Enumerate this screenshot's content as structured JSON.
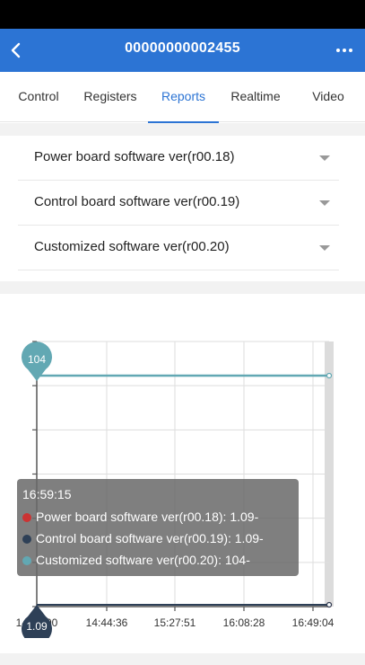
{
  "header": {
    "title": "00000000002455",
    "back_icon": "chevron-left-icon",
    "more_icon": "more-horizontal-icon",
    "background": "#2c74d4"
  },
  "tabs": [
    {
      "label": "Control",
      "active": false
    },
    {
      "label": "Registers",
      "active": false
    },
    {
      "label": "Reports",
      "active": true
    },
    {
      "label": "Realtime",
      "active": false
    },
    {
      "label": "Video",
      "active": false
    }
  ],
  "selects": [
    {
      "label": "Power board software ver(r00.18)"
    },
    {
      "label": "Control board software ver(r00.19)"
    },
    {
      "label": "Customized software ver(r00.20)"
    }
  ],
  "chart_data": {
    "type": "line",
    "x": [
      "14:04:00",
      "16:59:15"
    ],
    "xticks": [
      "14:04:00",
      "14:44:36",
      "15:27:51",
      "16:08:28",
      "16:49:04"
    ],
    "series": [
      {
        "name": "Power board software ver(r00.18)",
        "color": "#cc3333",
        "values": [
          "1.09-",
          "1.09-"
        ]
      },
      {
        "name": "Control board software ver(r00.19)",
        "color": "#2e4057",
        "values": [
          "1.09-",
          "1.09-"
        ]
      },
      {
        "name": "Customized software ver(r00.20)",
        "color": "#62a8b3",
        "values": [
          "104-",
          "104-"
        ]
      }
    ],
    "markers": [
      {
        "label": "104",
        "color": "#62a8b3"
      },
      {
        "label": "1.09",
        "color": "#2e4057"
      }
    ],
    "tooltip": {
      "time": "16:59:15",
      "rows": [
        {
          "text": "Power board software ver(r00.18): 1.09-",
          "color": "#cc3333"
        },
        {
          "text": "Control board software ver(r00.19): 1.09-",
          "color": "#2e4057"
        },
        {
          "text": "Customized software ver(r00.20): 104-",
          "color": "#62a8b3"
        }
      ]
    },
    "grid": true
  }
}
